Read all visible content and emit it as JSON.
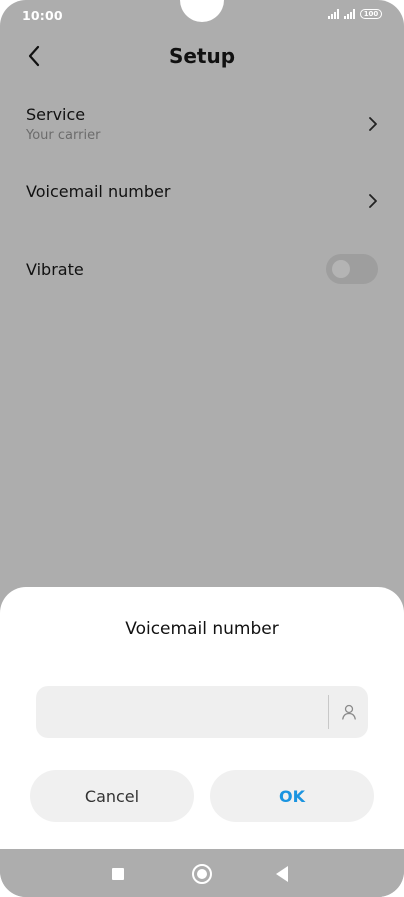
{
  "status_bar": {
    "time": "10:00",
    "battery": "100"
  },
  "header": {
    "title": "Setup",
    "back_icon": "chevron-left-icon"
  },
  "settings": {
    "service": {
      "title": "Service",
      "subtitle": "Your carrier"
    },
    "voicemail": {
      "title": "Voicemail number"
    },
    "vibrate": {
      "title": "Vibrate",
      "enabled": false
    }
  },
  "dialog": {
    "title": "Voicemail number",
    "input_value": "",
    "contacts_icon": "person-icon",
    "cancel_label": "Cancel",
    "ok_label": "OK",
    "ok_color": "#1a94e0"
  },
  "nav_bar": {
    "recents_icon": "square-icon",
    "home_icon": "circle-icon",
    "back_icon": "triangle-back-icon"
  }
}
